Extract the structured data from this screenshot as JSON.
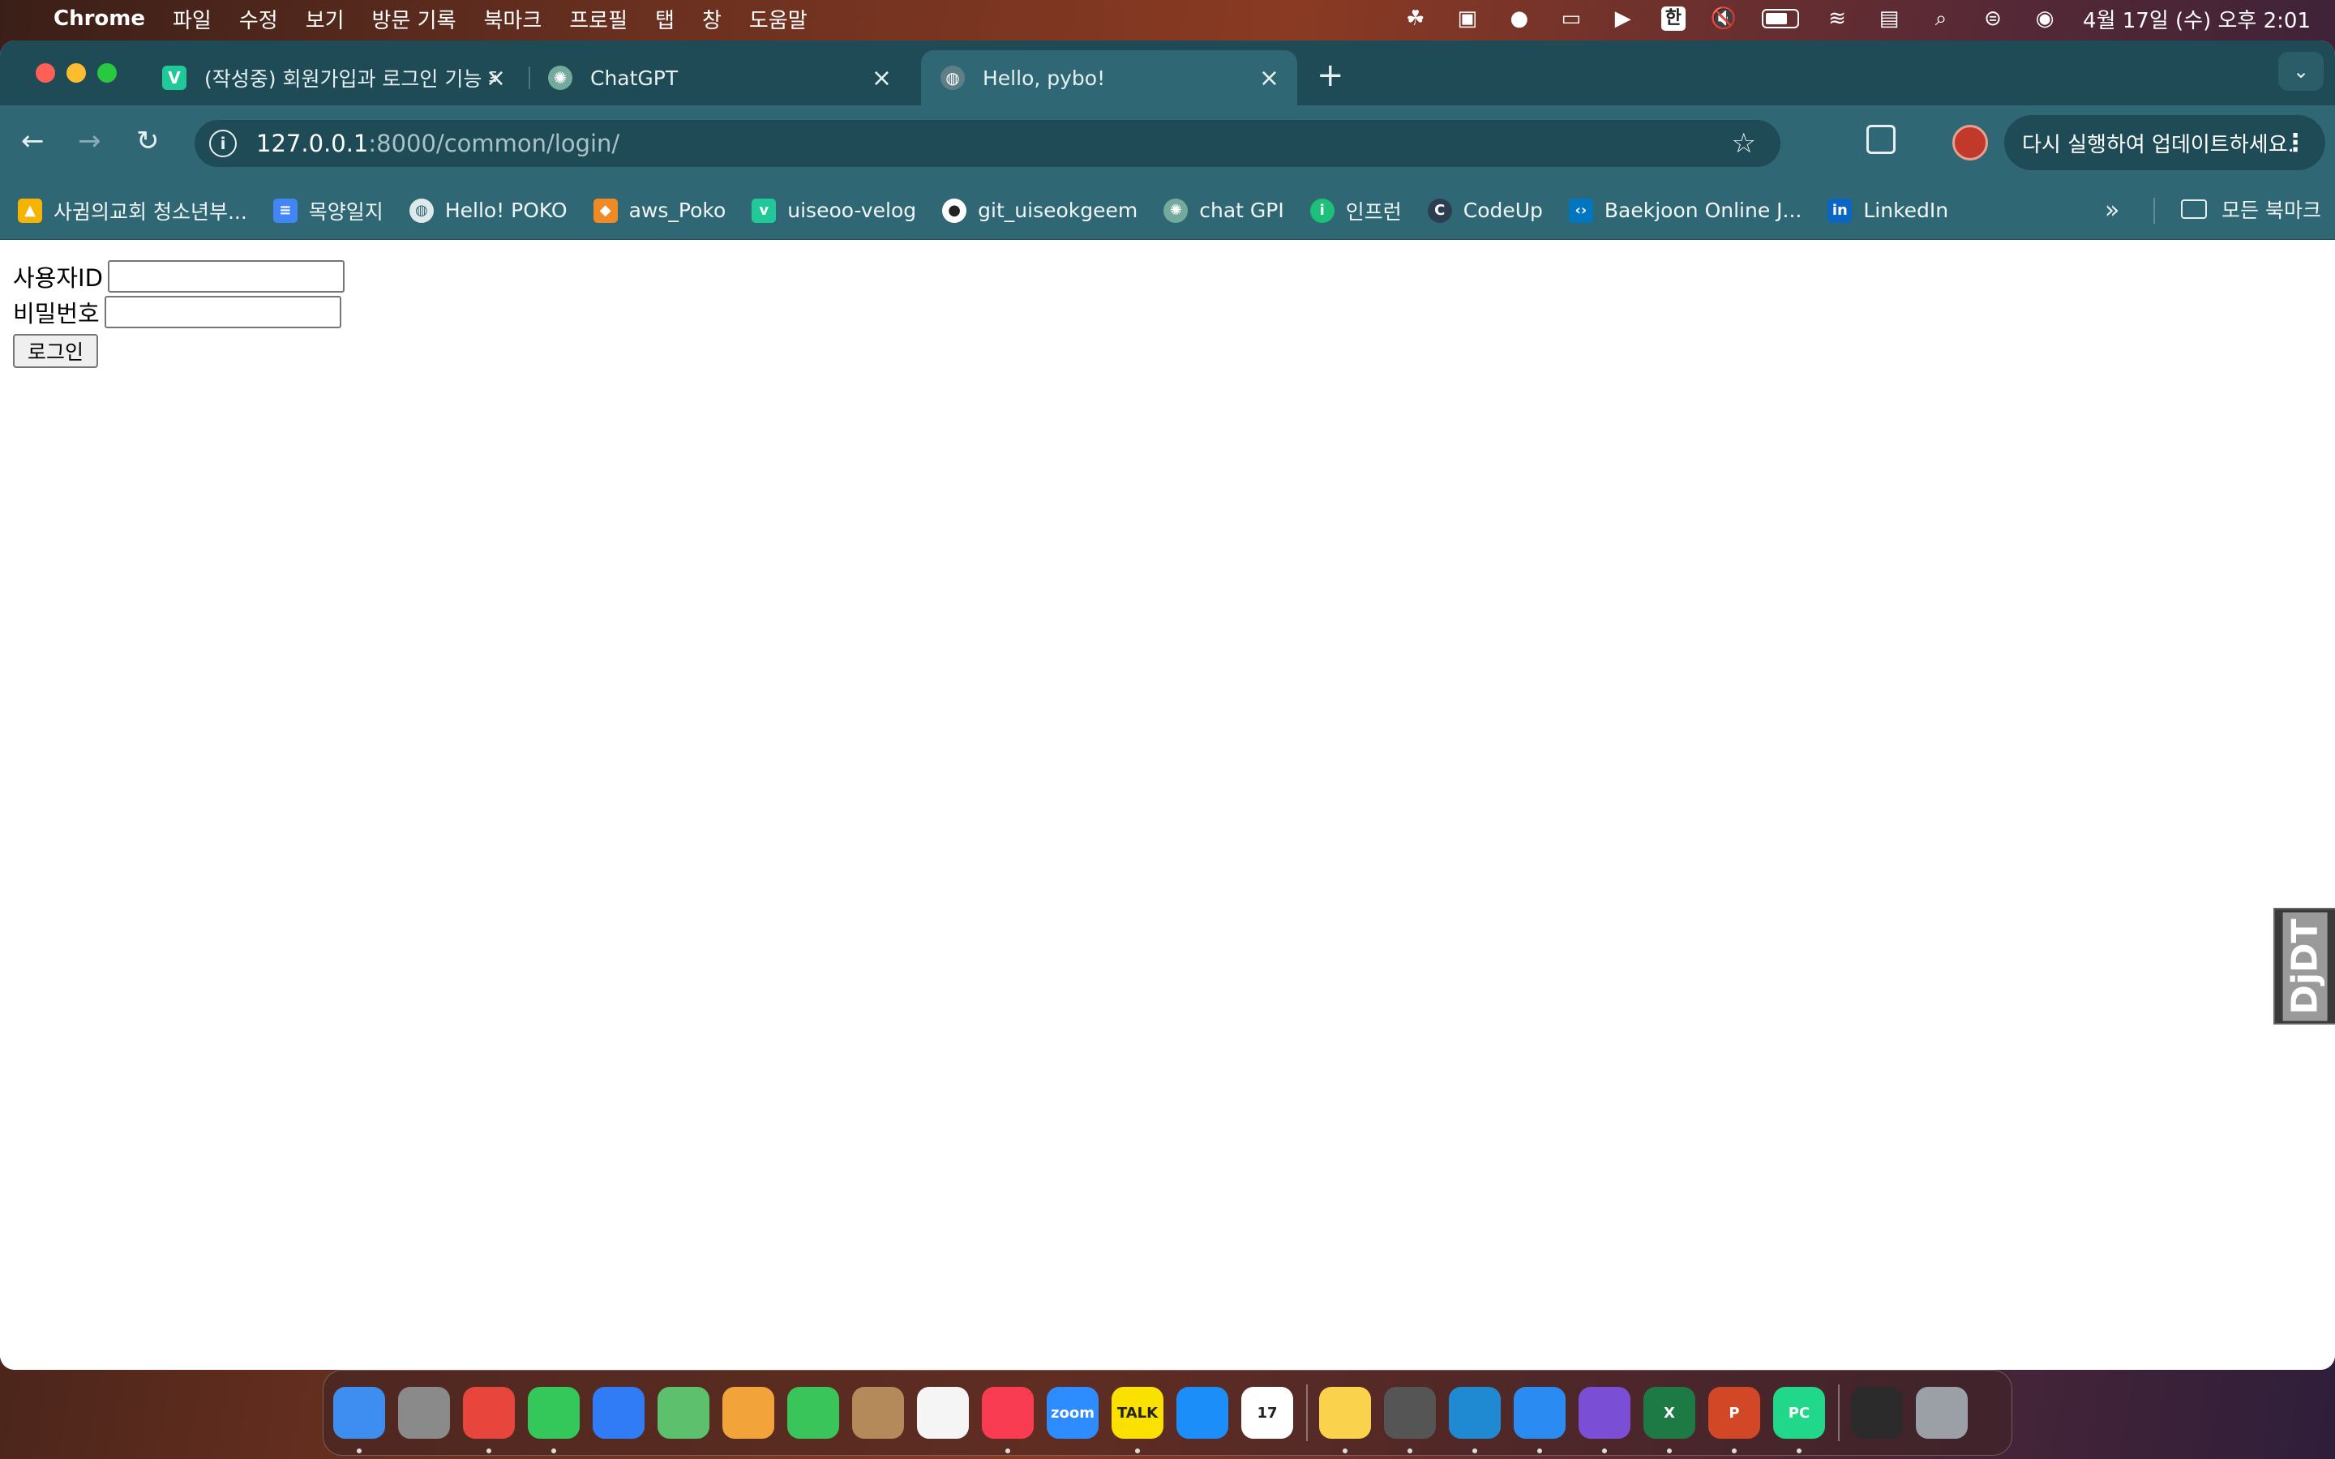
{
  "menubar": {
    "app": "Chrome",
    "items": [
      "파일",
      "수정",
      "보기",
      "방문 기록",
      "북마크",
      "프로필",
      "탭",
      "창",
      "도움말"
    ],
    "input_method": "한",
    "datetime": "4월 17일 (수) 오후 2:01"
  },
  "tabs": [
    {
      "title": "(작성중) 회원가입과 로그인 기능 추",
      "favicon": "V",
      "favicon_color": "#20c997"
    },
    {
      "title": "ChatGPT",
      "favicon": "ChatGPT-logo-icon",
      "favicon_color": "#74aa9c"
    },
    {
      "title": "Hello, pybo!",
      "favicon": "globe-icon",
      "favicon_color": "#5f7f87",
      "active": true
    }
  ],
  "omnibox": {
    "host": "127.0.0.1",
    "path": ":8000/common/login/"
  },
  "update_button": "다시 실행하여 업데이트하세요.",
  "bookmarks": [
    {
      "label": "사귐의교회 청소년부...",
      "icon": "google-drive-icon",
      "color": "#f4b400"
    },
    {
      "label": "목양일지",
      "icon": "google-docs-icon",
      "color": "#4285f4"
    },
    {
      "label": "Hello! POKO",
      "icon": "globe-icon",
      "color": "#dfe8ea"
    },
    {
      "label": "aws_Poko",
      "icon": "aws-cube-icon",
      "color": "#f08a24"
    },
    {
      "label": "uiseoo-velog",
      "icon": "velog-icon",
      "color": "#20c997"
    },
    {
      "label": "git_uiseokgeem",
      "icon": "github-icon",
      "color": "#ffffff"
    },
    {
      "label": "chat GPI",
      "icon": "chatgpt-icon",
      "color": "#74aa9c"
    },
    {
      "label": "인프런",
      "icon": "inflearn-icon",
      "color": "#1dc078"
    },
    {
      "label": "CodeUp",
      "icon": "codeup-icon",
      "color": "#2c3e50"
    },
    {
      "label": "Baekjoon Online J...",
      "icon": "baekjoon-icon",
      "color": "#0076c0"
    },
    {
      "label": "LinkedIn",
      "icon": "linkedin-icon",
      "color": "#0a66c2"
    }
  ],
  "all_bookmarks": "모든 북마크",
  "login": {
    "username_label": "사용자ID",
    "username_value": "",
    "password_label": "비밀번호",
    "password_value": "",
    "submit_label": "로그인"
  },
  "djdt": "DjDT",
  "dock": [
    {
      "name": "finder-icon",
      "color": "#3d8ef0",
      "running": true
    },
    {
      "name": "launchpad-icon",
      "color": "#8a8a8a",
      "running": false
    },
    {
      "name": "chrome-icon",
      "color": "#e8453c",
      "running": true
    },
    {
      "name": "messages-icon",
      "color": "#34c759",
      "running": true
    },
    {
      "name": "mail-icon",
      "color": "#2f7cf6",
      "running": false
    },
    {
      "name": "maps-icon",
      "color": "#5cc06c",
      "running": false
    },
    {
      "name": "photos-icon",
      "color": "#f2a33a",
      "running": false
    },
    {
      "name": "facetime-icon",
      "color": "#3ac55a",
      "running": false
    },
    {
      "name": "contacts-icon",
      "color": "#b48a5a",
      "running": false
    },
    {
      "name": "reminders-icon",
      "color": "#f5f5f5",
      "running": false
    },
    {
      "name": "music-icon",
      "color": "#fa3c52",
      "running": true
    },
    {
      "name": "zoom-icon",
      "color": "#2d8cff",
      "running": false,
      "text": "zoom"
    },
    {
      "name": "kakaotalk-icon",
      "color": "#fae100",
      "running": true,
      "text": "TALK"
    },
    {
      "name": "app-store-icon",
      "color": "#1c8ef9",
      "running": false
    },
    {
      "name": "calendar-icon",
      "color": "#ffffff",
      "running": false,
      "text": "17"
    },
    {
      "name": "notes-icon",
      "color": "#fbd24b",
      "running": true
    },
    {
      "name": "keychain-icon",
      "color": "#555555",
      "running": true
    },
    {
      "name": "vscode-icon",
      "color": "#1f8ad2",
      "running": true
    },
    {
      "name": "safari-icon",
      "color": "#2a8cf3",
      "running": true
    },
    {
      "name": "github-desktop-icon",
      "color": "#7a4fd6",
      "running": true
    },
    {
      "name": "excel-icon",
      "color": "#1d7a45",
      "running": true,
      "text": "X"
    },
    {
      "name": "powerpoint-icon",
      "color": "#d24726",
      "running": true,
      "text": "P"
    },
    {
      "name": "pycharm-icon",
      "color": "#21d789",
      "running": true,
      "text": "PC"
    },
    {
      "name": "terminal-icon",
      "color": "#2b2b2b",
      "running": false
    },
    {
      "name": "trash-icon",
      "color": "#9aa0a6",
      "running": false
    }
  ]
}
